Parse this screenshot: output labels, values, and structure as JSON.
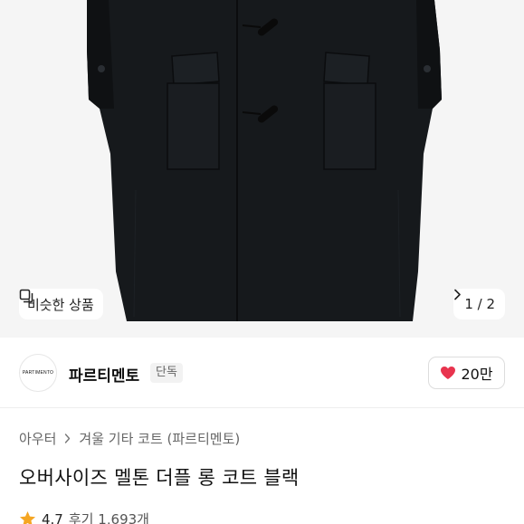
{
  "hero": {
    "similar_label": "비슷한 상품",
    "pager_text": "1 / 2",
    "image_subject": "black-duffle-coat"
  },
  "brand": {
    "logo_text": "PARTIMENTO",
    "name": "파르티멘토",
    "badge": "단독",
    "like_count": "20만"
  },
  "breadcrumb": {
    "items": [
      "아우터",
      "겨울 기타 코트 (파르티멘토)"
    ]
  },
  "product": {
    "title": "오버사이즈 멜톤 더플 롱 코트 블랙"
  },
  "rating": {
    "score": "4.7",
    "reviews_label": "후기 1,693개"
  },
  "colors": {
    "heart": "#e8344e",
    "star": "#f5a623",
    "coat": "#16191c"
  }
}
